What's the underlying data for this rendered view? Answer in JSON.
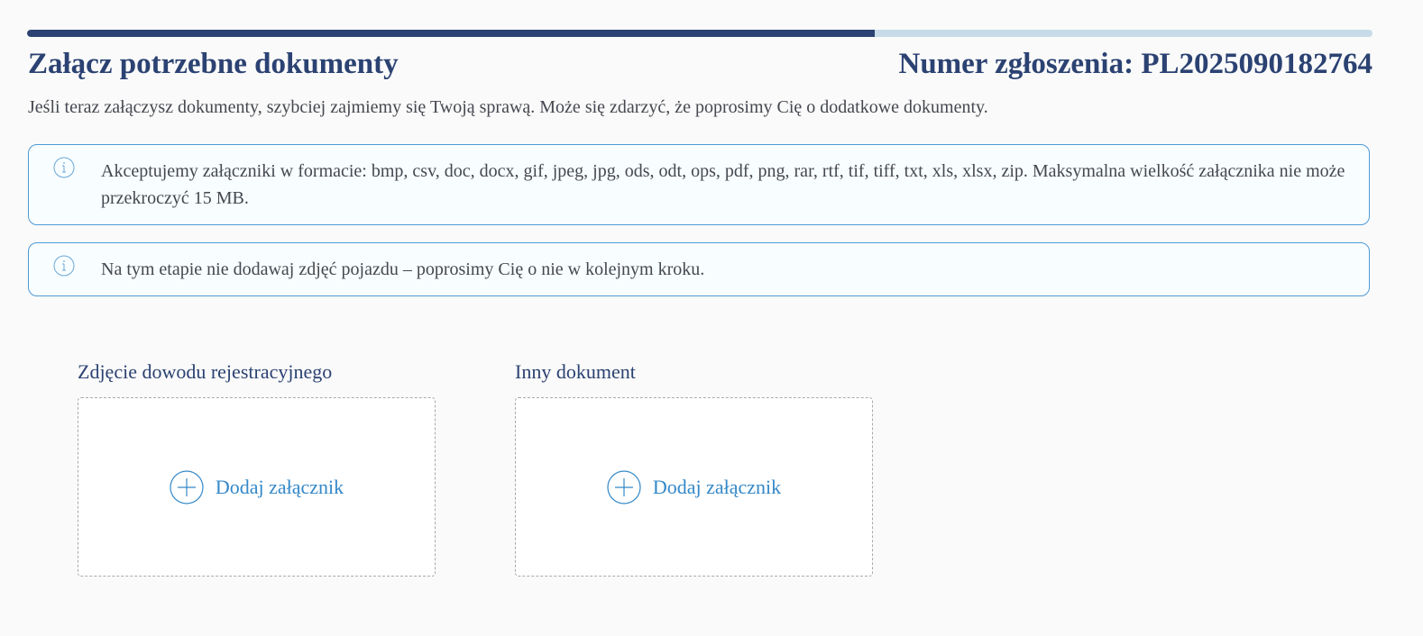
{
  "progress": {
    "value": 0.63,
    "fill_color": "#2b4272",
    "track_color": "#c7dbe8"
  },
  "header": {
    "title": "Załącz potrzebne dokumenty",
    "claim_number": "Numer zgłoszenia: PL2025090182764",
    "subtitle": "Jeśli teraz załączysz dokumenty, szybciej zajmiemy się Twoją sprawą. Może się zdarzyć, że poprosimy Cię o dodatkowe dokumenty."
  },
  "info_boxes": [
    {
      "icon": "info-icon",
      "text": "Akceptujemy załączniki w formacie: bmp, csv, doc, docx, gif, jpeg, jpg, ods, odt, ops, pdf, png, rar, rtf, tif, tiff, txt, xls, xlsx, zip. Maksymalna wielkość załącznika nie może przekroczyć 15 MB."
    },
    {
      "icon": "info-icon",
      "text": "Na tym etapie nie dodawaj zdjęć pojazdu – poprosimy Cię o nie w kolejnym kroku."
    }
  ],
  "uploads": [
    {
      "label": "Zdjęcie dowodu rejestracyjnego",
      "button_label": "Dodaj załącznik",
      "icon": "plus-circle-icon"
    },
    {
      "label": "Inny dokument",
      "button_label": "Dodaj załącznik",
      "icon": "plus-circle-icon"
    }
  ],
  "colors": {
    "heading": "#2b4272",
    "accent": "#3488c8",
    "info_border": "#4f9ad6",
    "body_text": "#45484f"
  }
}
